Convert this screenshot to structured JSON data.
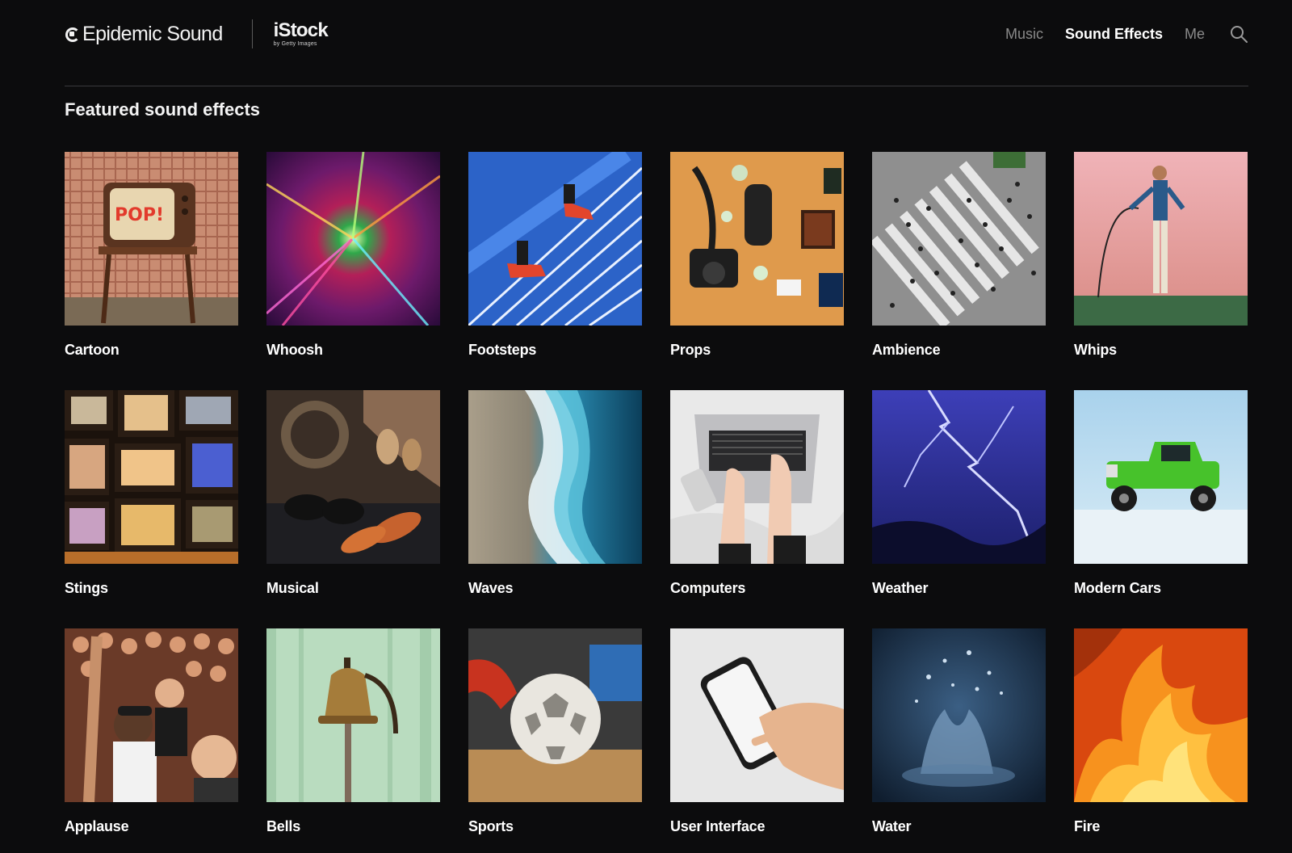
{
  "header": {
    "brand_name": "Epidemic Sound",
    "partner_name": "iStock",
    "partner_sub": "by Getty Images",
    "nav": [
      {
        "label": "Music",
        "active": false
      },
      {
        "label": "Sound Effects",
        "active": true
      },
      {
        "label": "Me",
        "active": false
      }
    ]
  },
  "section": {
    "title": "Featured sound effects"
  },
  "categories": [
    {
      "label": "Cartoon",
      "icon": "tv-pop-image"
    },
    {
      "label": "Whoosh",
      "icon": "light-tunnel-image"
    },
    {
      "label": "Footsteps",
      "icon": "stairs-sneakers-image"
    },
    {
      "label": "Props",
      "icon": "camera-flatlay-image"
    },
    {
      "label": "Ambience",
      "icon": "crosswalk-crowd-image"
    },
    {
      "label": "Whips",
      "icon": "whip-performer-image"
    },
    {
      "label": "Stings",
      "icon": "tv-wall-image"
    },
    {
      "label": "Musical",
      "icon": "percussion-instruments-image"
    },
    {
      "label": "Waves",
      "icon": "ocean-wave-image"
    },
    {
      "label": "Computers",
      "icon": "laptop-typing-image"
    },
    {
      "label": "Weather",
      "icon": "lightning-storm-image"
    },
    {
      "label": "Modern Cars",
      "icon": "green-truck-image"
    },
    {
      "label": "Applause",
      "icon": "cheering-crowd-image"
    },
    {
      "label": "Bells",
      "icon": "brass-bell-image"
    },
    {
      "label": "Sports",
      "icon": "soccer-ball-image"
    },
    {
      "label": "User Interface",
      "icon": "smartphone-hand-image"
    },
    {
      "label": "Water",
      "icon": "water-splash-image"
    },
    {
      "label": "Fire",
      "icon": "flames-image"
    }
  ]
}
